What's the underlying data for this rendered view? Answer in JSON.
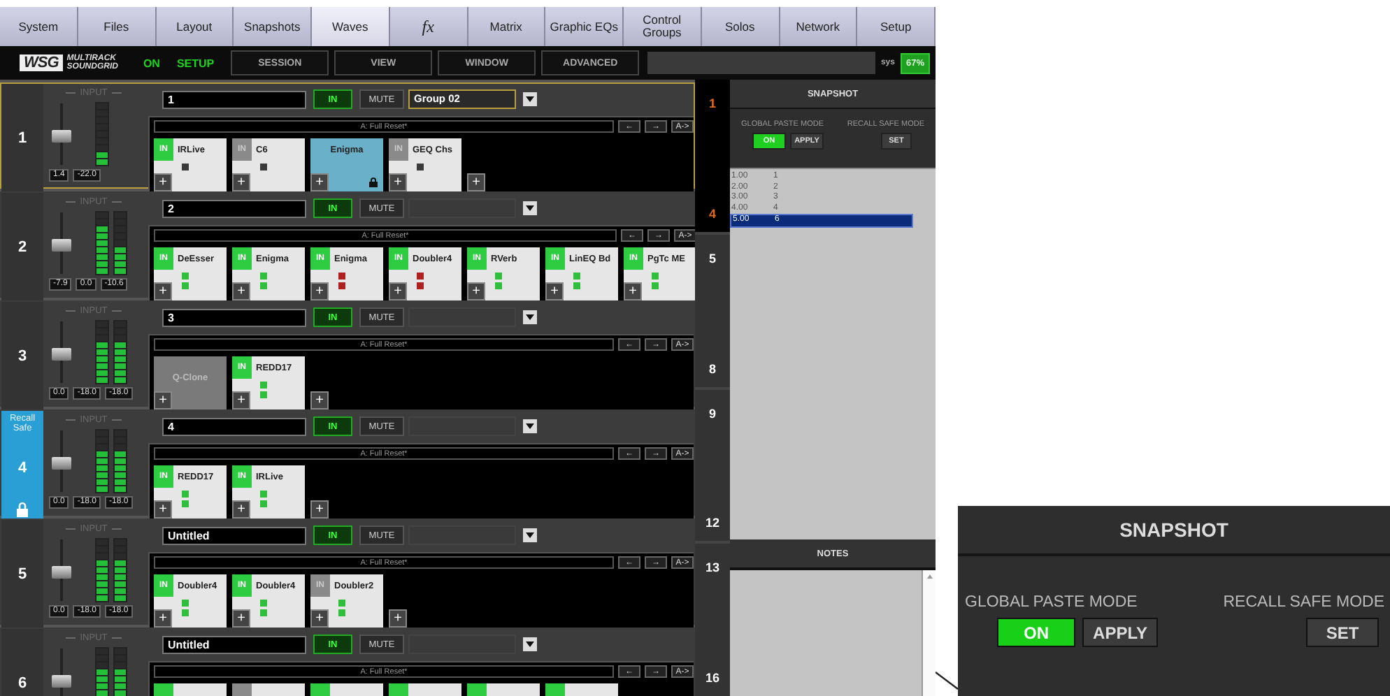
{
  "tabs": [
    {
      "label": "System",
      "kind": "text",
      "selected": false
    },
    {
      "label": "Files",
      "kind": "text",
      "selected": false
    },
    {
      "label": "Layout",
      "kind": "text",
      "selected": false
    },
    {
      "label": "Snapshots",
      "kind": "text",
      "selected": false
    },
    {
      "label": "Waves",
      "kind": "text",
      "selected": true
    },
    {
      "label": "fx",
      "kind": "script",
      "selected": false
    },
    {
      "label": "Matrix",
      "kind": "text",
      "selected": false
    },
    {
      "label": "Graphic EQs",
      "kind": "text",
      "selected": false
    },
    {
      "label": "Control Groups",
      "kind": "text",
      "selected": false
    },
    {
      "label": "Solos",
      "kind": "text",
      "selected": false
    },
    {
      "label": "Network",
      "kind": "text",
      "selected": false
    },
    {
      "label": "Setup",
      "kind": "text",
      "selected": false
    }
  ],
  "toolbar": {
    "logo_mark": "WSG",
    "logo_lines": [
      "MULTIRACK",
      "SOUNDGRID"
    ],
    "status": "ON",
    "mode": "SETUP",
    "menus": [
      "SESSION",
      "VIEW",
      "WINDOW",
      "ADVANCED"
    ],
    "sys_label": "sys",
    "sys_value": "67%"
  },
  "strips": [
    {
      "number": "1",
      "selected": true,
      "recall_safe": false,
      "input_label": "INPUT",
      "name": "1",
      "in_label": "IN",
      "mute_label": "MUTE",
      "group": "Group 02",
      "preset": "A: Full Reset*",
      "preset_buttons": [
        "←",
        "→",
        "A->"
      ],
      "fader": {
        "level": 0.45,
        "reading": "1.4"
      },
      "meters": [
        {
          "level": 0.22,
          "reading": "-22.0"
        }
      ],
      "slots": [
        {
          "kind": "plugin",
          "in": true,
          "in_label": "IN",
          "name": "IRLive",
          "plus": "+",
          "leds": [
            {
              "color": "#3a3a3a"
            }
          ]
        },
        {
          "kind": "plugin",
          "in": false,
          "in_label": "IN",
          "name": "C6",
          "plus": "+",
          "leds": [
            {
              "color": "#3a3a3a"
            }
          ]
        },
        {
          "kind": "locked",
          "name": "Enigma",
          "plus": "+"
        },
        {
          "kind": "plugin",
          "in": false,
          "in_label": "IN",
          "name": "GEQ Chs",
          "plus": "+",
          "leds": [
            {
              "color": "#3a3a3a"
            }
          ]
        }
      ],
      "add_button": "+"
    },
    {
      "number": "2",
      "selected": false,
      "recall_safe": false,
      "input_label": "INPUT",
      "name": "2",
      "in_label": "IN",
      "mute_label": "MUTE",
      "preset": "A: Full Reset*",
      "preset_buttons": [
        "←",
        "→",
        "A->"
      ],
      "fader": {
        "level": 0.45,
        "reading": "-7.9"
      },
      "meters": [
        {
          "level": 0.78,
          "reading": "0.0"
        },
        {
          "level": 0.45,
          "reading": "-10.6"
        }
      ],
      "slots": [
        {
          "kind": "plugin",
          "in": true,
          "in_label": "IN",
          "name": "DeEsser",
          "plus": "+",
          "leds": [
            {
              "color": "#2fbf3a"
            },
            {
              "color": "#2fbf3a"
            }
          ]
        },
        {
          "kind": "plugin",
          "in": true,
          "in_label": "IN",
          "name": "Enigma",
          "plus": "+",
          "leds": [
            {
              "color": "#2fbf3a"
            },
            {
              "color": "#2fbf3a"
            }
          ]
        },
        {
          "kind": "plugin",
          "in": true,
          "in_label": "IN",
          "name": "Enigma",
          "plus": "+",
          "leds": [
            {
              "color": "#b02020"
            },
            {
              "color": "#b02020"
            }
          ]
        },
        {
          "kind": "plugin",
          "in": true,
          "in_label": "IN",
          "name": "Doubler4",
          "plus": "+",
          "leds": [
            {
              "color": "#b02020"
            },
            {
              "color": "#b02020"
            }
          ]
        },
        {
          "kind": "plugin",
          "in": true,
          "in_label": "IN",
          "name": "RVerb",
          "plus": "+",
          "leds": [
            {
              "color": "#2fbf3a"
            },
            {
              "color": "#2fbf3a"
            }
          ]
        },
        {
          "kind": "plugin",
          "in": true,
          "in_label": "IN",
          "name": "LinEQ Bd",
          "plus": "+",
          "leds": [
            {
              "color": "#2fbf3a"
            },
            {
              "color": "#2fbf3a"
            }
          ]
        },
        {
          "kind": "plugin",
          "in": true,
          "in_label": "IN",
          "name": "PgTc ME",
          "plus": "+",
          "leds": [
            {
              "color": "#2fbf3a"
            },
            {
              "color": "#2fbf3a"
            }
          ]
        }
      ]
    },
    {
      "number": "3",
      "selected": false,
      "recall_safe": false,
      "input_label": "INPUT",
      "name": "3",
      "in_label": "IN",
      "mute_label": "MUTE",
      "preset": "A: Full Reset*",
      "preset_buttons": [
        "←",
        "→",
        "A->"
      ],
      "fader": {
        "level": 0.45,
        "reading": "0.0"
      },
      "meters": [
        {
          "level": 0.67,
          "reading": "-18.0"
        },
        {
          "level": 0.67,
          "reading": "-18.0"
        }
      ],
      "slots": [
        {
          "kind": "bypassed",
          "name": "Q-Clone",
          "plus": "+"
        },
        {
          "kind": "plugin",
          "in": true,
          "in_label": "IN",
          "name": "REDD17",
          "plus": "+",
          "leds": [
            {
              "color": "#2fbf3a"
            },
            {
              "color": "#2fbf3a"
            }
          ]
        }
      ],
      "add_button": "+"
    },
    {
      "number": "4",
      "selected": false,
      "recall_safe": true,
      "recall_label": "Recall Safe",
      "input_label": "INPUT",
      "name": "4",
      "in_label": "IN",
      "mute_label": "MUTE",
      "preset": "A: Full Reset*",
      "preset_buttons": [
        "←",
        "→",
        "A->"
      ],
      "fader": {
        "level": 0.45,
        "reading": "0.0"
      },
      "meters": [
        {
          "level": 0.67,
          "reading": "-18.0"
        },
        {
          "level": 0.67,
          "reading": "-18.0"
        }
      ],
      "slots": [
        {
          "kind": "plugin",
          "in": true,
          "in_label": "IN",
          "name": "REDD17",
          "plus": "+",
          "leds": [
            {
              "color": "#2fbf3a"
            },
            {
              "color": "#2fbf3a"
            }
          ]
        },
        {
          "kind": "plugin",
          "in": true,
          "in_label": "IN",
          "name": "IRLive",
          "plus": "+",
          "leds": [
            {
              "color": "#2fbf3a"
            },
            {
              "color": "#2fbf3a"
            }
          ]
        }
      ],
      "add_button": "+"
    },
    {
      "number": "5",
      "selected": false,
      "recall_safe": false,
      "input_label": "INPUT",
      "name": "Untitled",
      "in_label": "IN",
      "mute_label": "MUTE",
      "preset": "A: Full Reset*",
      "preset_buttons": [
        "←",
        "→",
        "A->"
      ],
      "fader": {
        "level": 0.45,
        "reading": "0.0"
      },
      "meters": [
        {
          "level": 0.67,
          "reading": "-18.0"
        },
        {
          "level": 0.67,
          "reading": "-18.0"
        }
      ],
      "slots": [
        {
          "kind": "plugin",
          "in": true,
          "in_label": "IN",
          "name": "Doubler4",
          "plus": "+",
          "leds": [
            {
              "color": "#2fbf3a"
            },
            {
              "color": "#2fbf3a"
            }
          ]
        },
        {
          "kind": "plugin",
          "in": true,
          "in_label": "IN",
          "name": "Doubler4",
          "plus": "+",
          "leds": [
            {
              "color": "#2fbf3a"
            },
            {
              "color": "#2fbf3a"
            }
          ]
        },
        {
          "kind": "plugin",
          "in": false,
          "in_label": "IN",
          "name": "Doubler2",
          "plus": "+",
          "leds": [
            {
              "color": "#2fbf3a"
            },
            {
              "color": "#2fbf3a"
            }
          ]
        }
      ],
      "add_button": "+"
    },
    {
      "number": "6",
      "selected": false,
      "recall_safe": false,
      "input_label": "INPUT",
      "name": "Untitled",
      "in_label": "IN",
      "mute_label": "MUTE",
      "preset": "A: Full Reset*",
      "preset_buttons": [
        "←",
        "→",
        "A->"
      ],
      "fader": {
        "level": 0.45
      },
      "meters": [
        {
          "level": 0.67
        },
        {
          "level": 0.67
        }
      ],
      "slots": [
        {
          "kind": "plugin",
          "in": true
        },
        {
          "kind": "plugin",
          "in": false
        },
        {
          "kind": "plugin",
          "in": true
        },
        {
          "kind": "plugin",
          "in": true
        },
        {
          "kind": "plugin",
          "in": true
        },
        {
          "kind": "plugin",
          "in": true
        }
      ]
    }
  ],
  "banks": [
    {
      "first": "1",
      "last": "4",
      "selected": true
    },
    {
      "first": "5",
      "last": "8",
      "selected": false
    },
    {
      "first": "9",
      "last": "12",
      "selected": false
    },
    {
      "first": "13",
      "last": "16",
      "selected": false
    }
  ],
  "snapshot": {
    "title": "SNAPSHOT",
    "paste_label": "GLOBAL PASTE MODE",
    "recall_label": "RECALL SAFE MODE",
    "on_button": {
      "label": "ON",
      "on": true
    },
    "apply_button": "APPLY",
    "set_button": "SET",
    "list": [
      {
        "number": "1.00",
        "name": "1",
        "selected": false
      },
      {
        "number": "2.00",
        "name": "2",
        "selected": false
      },
      {
        "number": "3.00",
        "name": "3",
        "selected": false
      },
      {
        "number": "4.00",
        "name": "4",
        "selected": false
      },
      {
        "number": "5.00",
        "name": "6",
        "selected": true
      }
    ],
    "notes_title": "NOTES"
  },
  "zoom_inset": {
    "title": "SNAPSHOT",
    "paste_label": "GLOBAL PASTE MODE",
    "recall_label": "RECALL SAFE MODE",
    "on_button": {
      "label": "ON",
      "on": true
    },
    "apply_button": "APPLY",
    "set_button": "SET"
  }
}
